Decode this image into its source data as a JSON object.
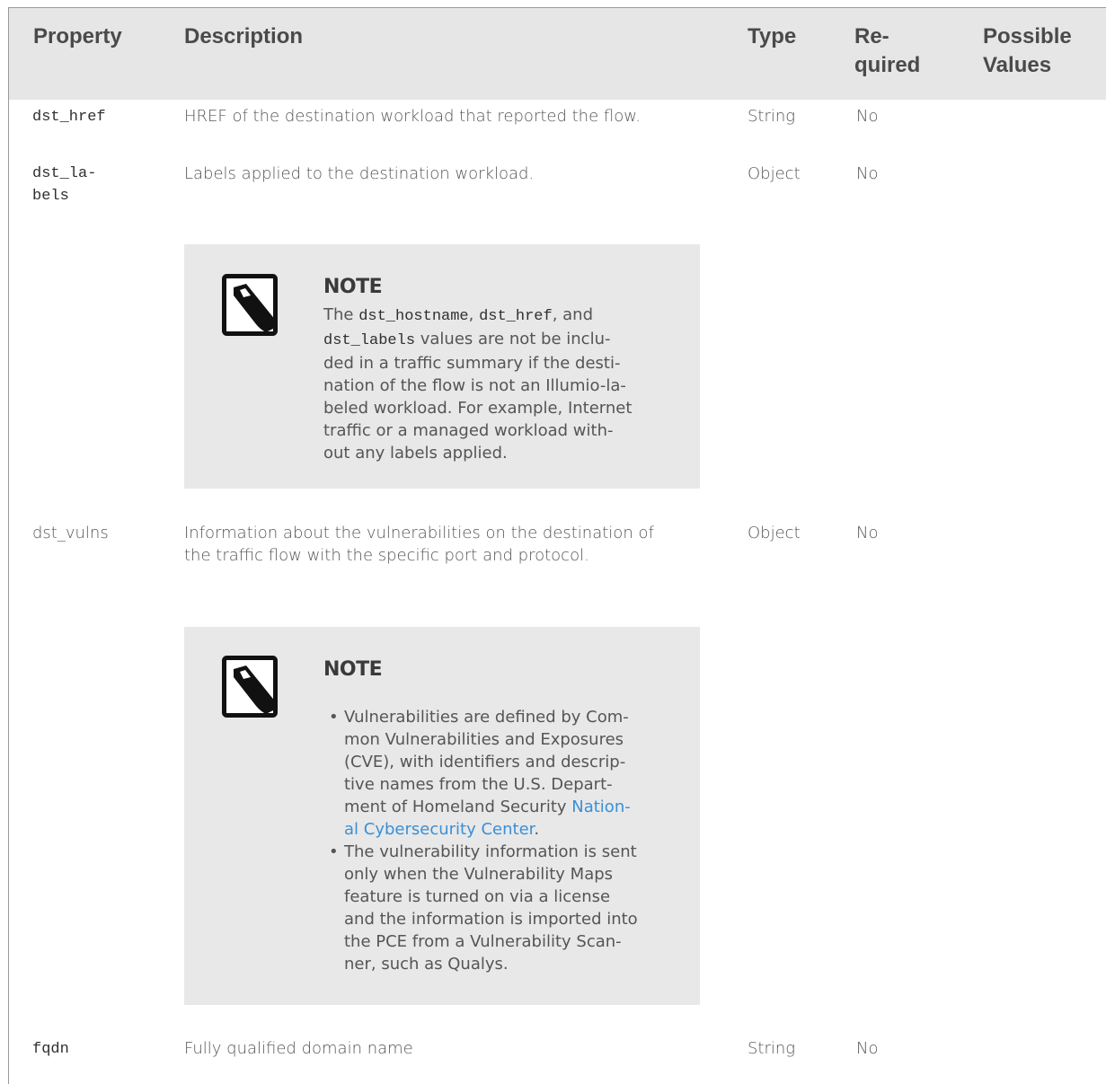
{
  "header": {
    "property": "Property",
    "description": "Description",
    "type": "Type",
    "required_line1": "Re-",
    "required_line2": "quired",
    "possible_line1": "Possible",
    "possible_line2": "Values"
  },
  "rows": [
    {
      "property": "dst_href",
      "description": "HREF of the destination workload that reported the flow.",
      "type": "String",
      "required": "No"
    },
    {
      "property_line1": "dst_la-",
      "property_line2": "bels",
      "description": "Labels applied to the destination workload.",
      "type": "Object",
      "required": "No"
    },
    {
      "property": "dst_vulns",
      "description_line1": "Information about the vulnerabilities on the destination of",
      "description_line2": "the traffic flow with the specific port and protocol.",
      "type": "Object",
      "required": "No"
    },
    {
      "property": "fqdn",
      "description": "Fully qualified domain name",
      "type": "String",
      "required": "No"
    }
  ],
  "note1": {
    "icon": "note-pencil-icon",
    "title": "NOTE",
    "lines": [
      {
        "pre": "The ",
        "code1": "dst_hostname",
        "mid1": ", ",
        "code2": "dst_href",
        "mid2": ", and"
      },
      {
        "code": "dst_labels",
        "post": " values are not be inclu-"
      },
      "ded in a traffic summary if the desti-",
      "nation of the flow is not an Illumio-la-",
      "beled workload. For example, Internet",
      "traffic or a managed workload with-",
      "out any labels applied."
    ]
  },
  "note2": {
    "icon": "note-pencil-icon",
    "title": "NOTE",
    "bullet": "•",
    "item1": {
      "lines": [
        "Vulnerabilities are defined by Com-",
        "mon Vulnerabilities and Exposures",
        "(CVE), with identifiers and descrip-",
        "tive names from the U.S. Depart-"
      ],
      "line5_pre": "ment of Homeland Security ",
      "link_part1": "Nation-",
      "link_part2": "al Cybersecurity Center",
      "line6_post": "."
    },
    "item2": {
      "lines": [
        "The vulnerability information is sent",
        "only when the Vulnerability Maps",
        "feature is turned on via a license",
        "and the information is imported into",
        "the PCE from a Vulnerability Scan-",
        "ner, such as Qualys."
      ]
    }
  },
  "colors": {
    "header_bg": "#e6e6e6",
    "note_bg": "#e8e8e8",
    "link": "#3a8fd6",
    "text": "#555555"
  }
}
